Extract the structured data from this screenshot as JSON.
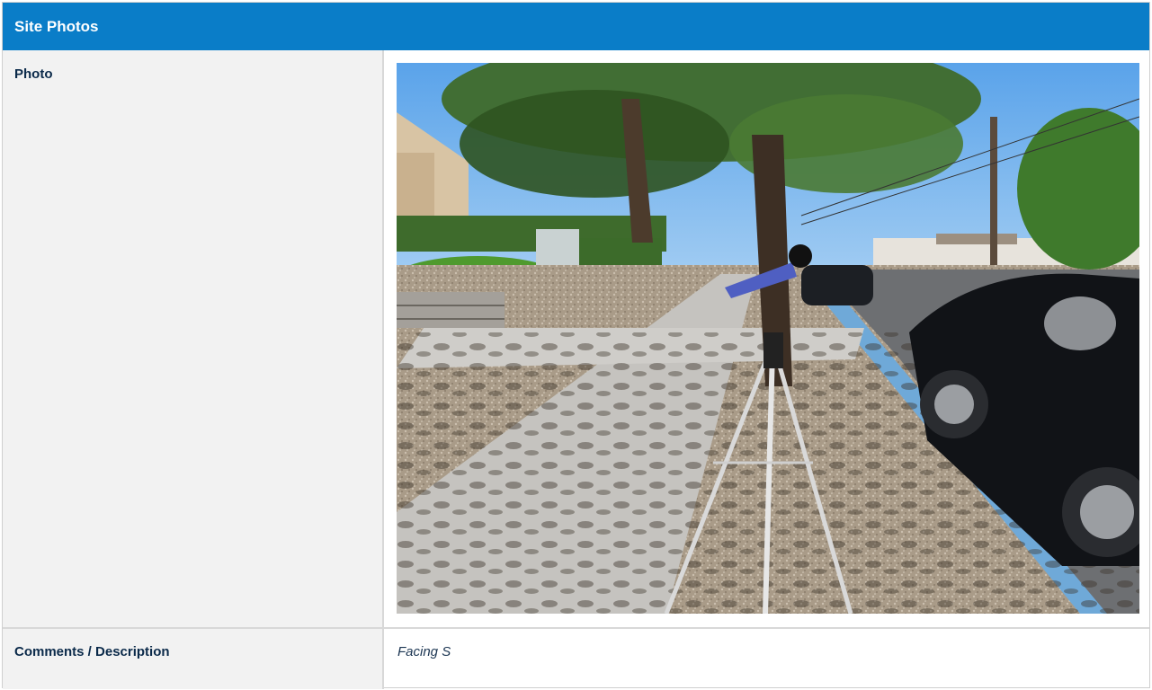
{
  "section": {
    "title": "Site Photos"
  },
  "rows": {
    "photo": {
      "label": "Photo"
    },
    "comments": {
      "label": "Comments / Description",
      "value": "Facing S"
    }
  },
  "colors": {
    "header_bg": "#0a7dc8",
    "label_bg": "#f2f2f2",
    "label_text": "#0b2a4a"
  }
}
